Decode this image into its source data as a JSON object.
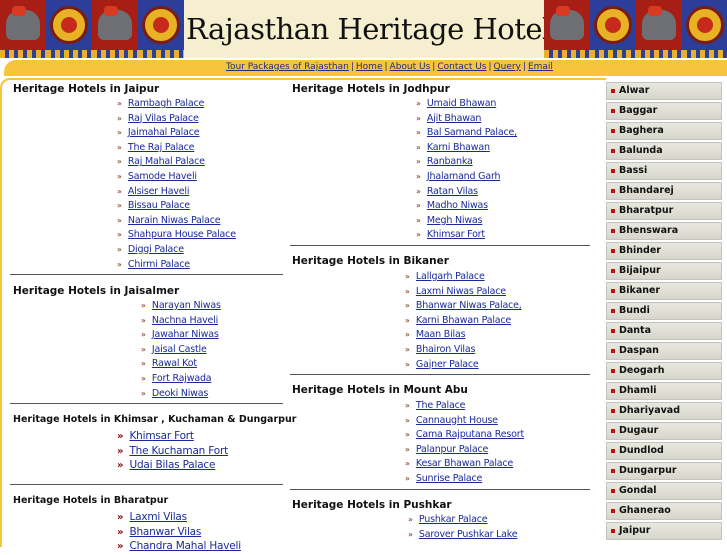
{
  "header": {
    "title": "Rajasthan Heritage Hotels"
  },
  "nav": {
    "links": [
      "Tour Packages of Rajasthan",
      "Home",
      "About Us",
      "Contact Us",
      "Query",
      "Email"
    ],
    "separator": "|"
  },
  "sections": {
    "jaipur": {
      "title": "Heritage Hotels in Jaipur",
      "hotels": [
        "Rambagh Palace",
        "Raj Vilas Palace",
        "Jaimahal Palace",
        "The Raj Palace",
        "Raj Mahal Palace",
        "Samode Haveli",
        "Alsiser Haveli",
        "Bissau Palace",
        "Narain Niwas Palace",
        "Shahpura House Palace",
        "Diggi Palace",
        "Chirmi Palace"
      ]
    },
    "jaisalmer": {
      "title": "Heritage Hotels in Jaisalmer",
      "hotels": [
        "Narayan Niwas",
        "Nachna Haveli",
        "Jawahar Niwas",
        "Jaisal Castle",
        "Rawal Kot",
        "Fort Rajwada",
        "Deoki Niwas"
      ]
    },
    "khimsar": {
      "title": "Heritage Hotels in Khimsar , Kuchaman & Dungarpur",
      "hotels": [
        "Khimsar Fort",
        "The Kuchaman Fort",
        "Udai Bilas Palace"
      ]
    },
    "bharatpur": {
      "title": "Heritage Hotels in Bharatpur",
      "hotels": [
        "Laxmi Vilas",
        "Bhanwar Vilas",
        "Chandra Mahal Haveli"
      ]
    },
    "jodhpur": {
      "title": "Heritage Hotels in Jodhpur",
      "hotels": [
        "Umaid Bhawan",
        "Ajit Bhawan",
        "Bal Samand Palace,",
        "Karni Bhawan",
        "Ranbanka",
        "Jhalamand Garh",
        "Ratan Vilas",
        "Madho Niwas",
        "Megh Niwas",
        "Khimsar Fort"
      ]
    },
    "bikaner": {
      "title": "Heritage Hotels in Bikaner",
      "hotels": [
        "Lallgarh Palace",
        "Laxmi Niwas Palace",
        "Bhanwar Niwas Palace,",
        "Karni Bhawan Palace",
        "Maan Bilas",
        "Bhairon Vilas",
        "Gajner Palace"
      ]
    },
    "mountabu": {
      "title": "Heritage Hotels in Mount Abu",
      "hotels": [
        "The Palace",
        "Cannaught House",
        "Cama Rajputana Resort",
        "Palanpur Palace",
        "Kesar Bhawan Palace",
        "Sunrise Palace"
      ]
    },
    "pushkar": {
      "title": "Heritage Hotels in Pushkar",
      "hotels": [
        "Pushkar Palace",
        "Sarover Pushkar Lake"
      ]
    }
  },
  "sidebar": {
    "cities": [
      "Alwar",
      "Baggar",
      "Baghera",
      "Balunda",
      "Bassi",
      "Bhandarej",
      "Bharatpur",
      "Bhenswara",
      "Bhinder",
      "Bijaipur",
      "Bikaner",
      "Bundi",
      "Danta",
      "Daspan",
      "Deogarh",
      "Dhamli",
      "Dhariyavad",
      "Dugaur",
      "Dundlod",
      "Dungarpur",
      "Gondal",
      "Ghanerao",
      "Jaipur"
    ]
  },
  "colors": {
    "accent": "#f6c43d",
    "link": "#1a2a9a",
    "banner_bg": "#f6efcf"
  }
}
